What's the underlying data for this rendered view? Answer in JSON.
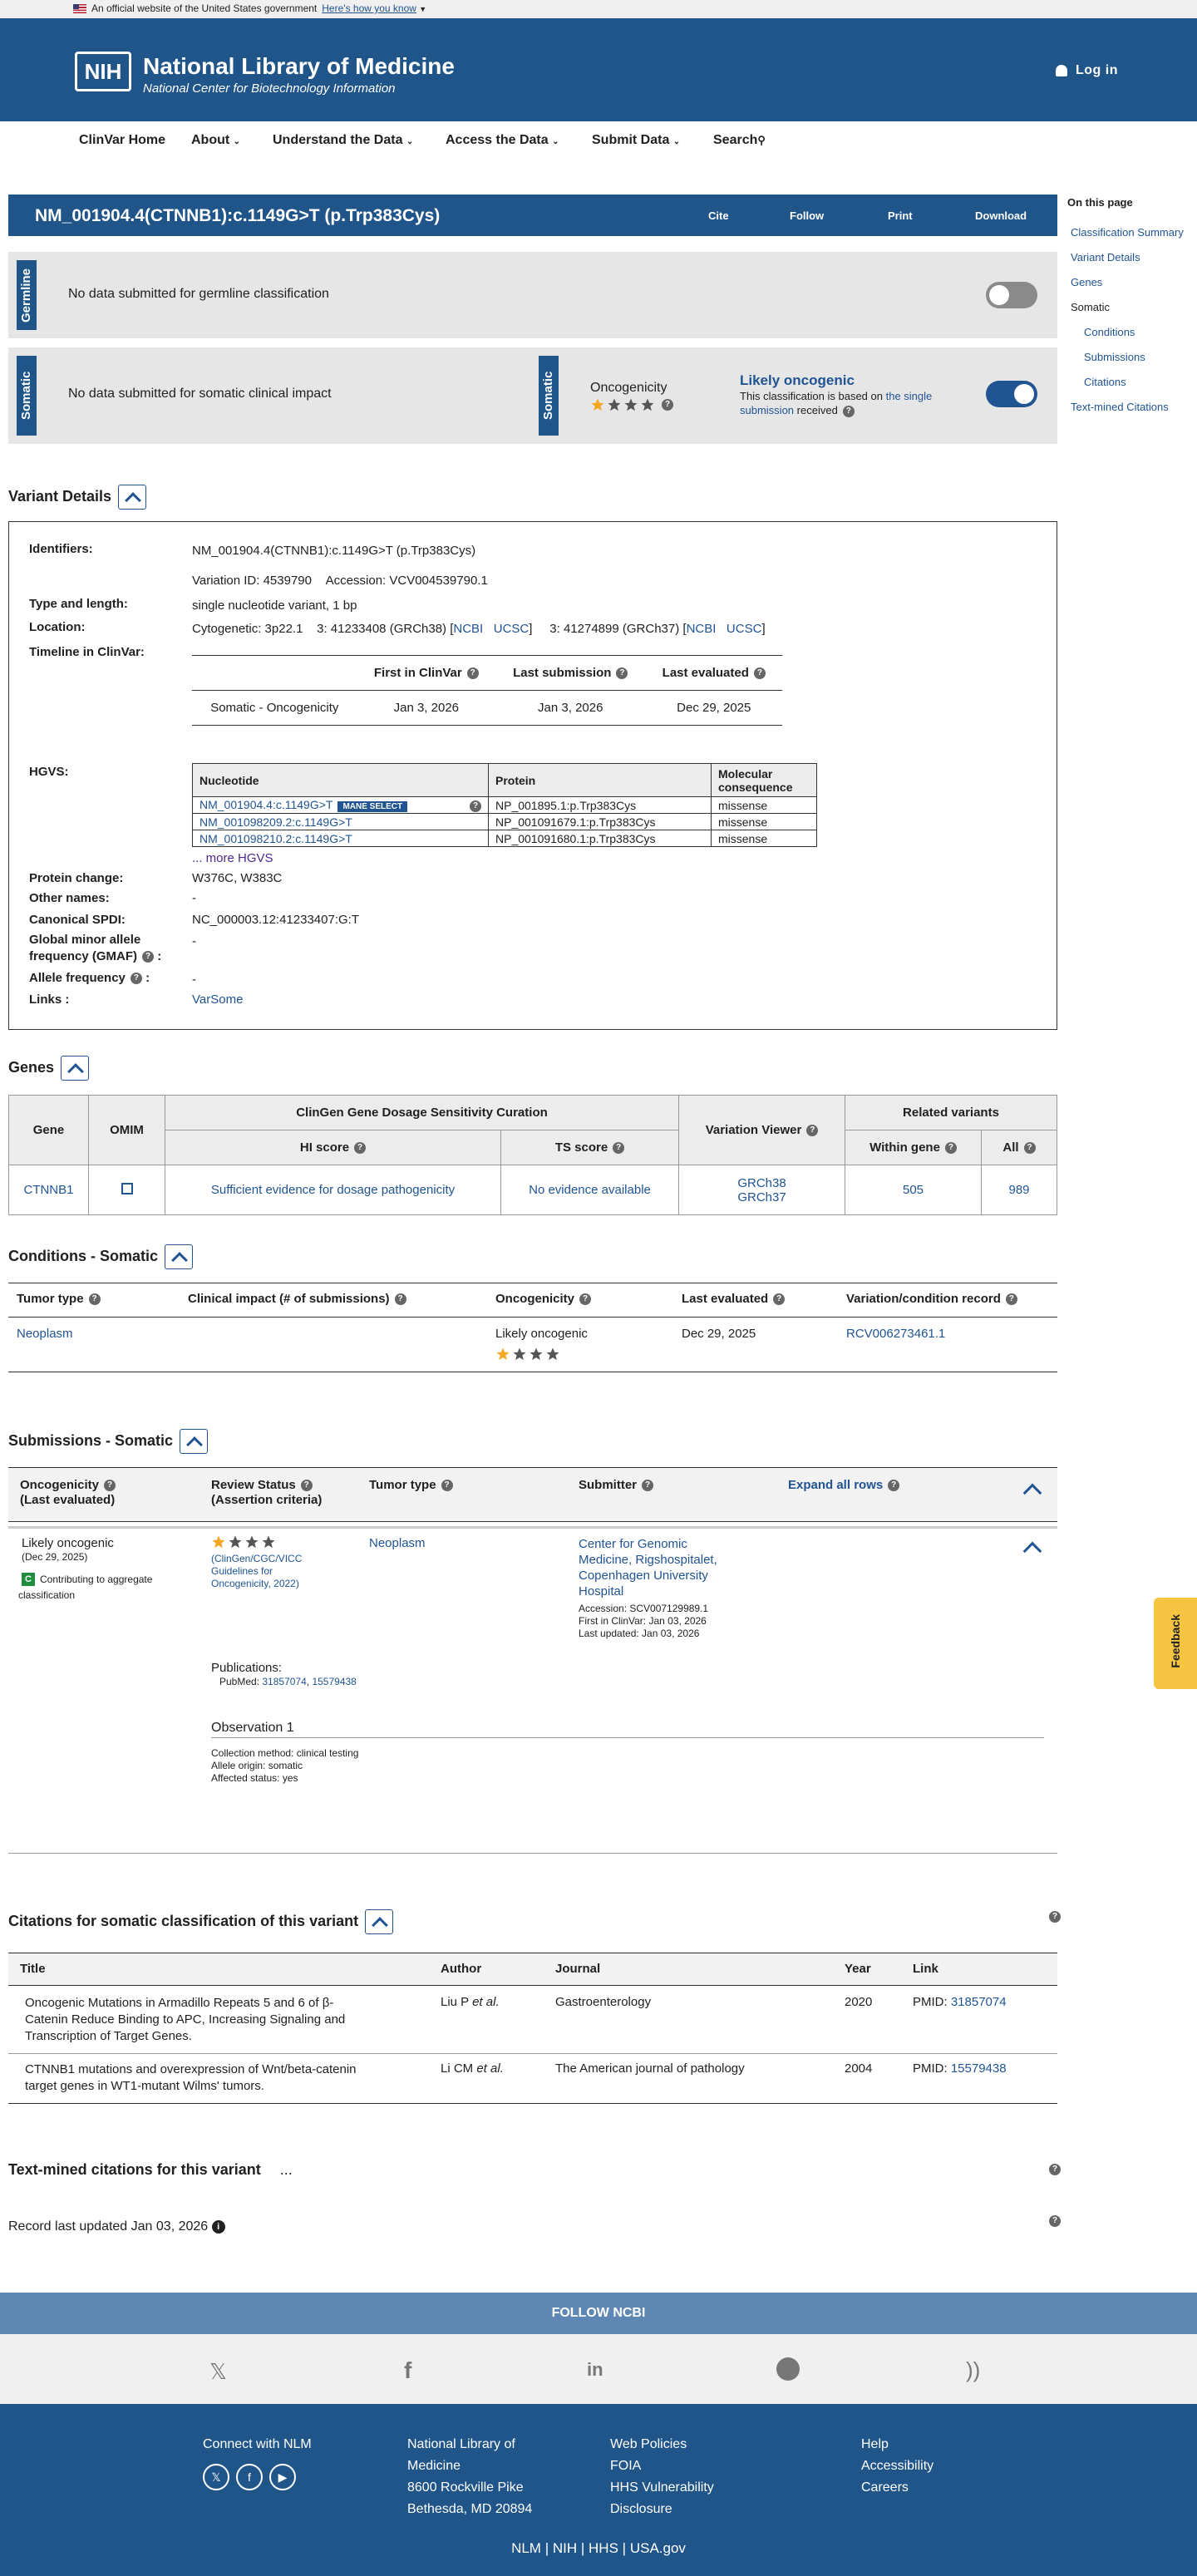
{
  "gov_banner": {
    "text": "An official website of the United States government",
    "link": "Here's how you know"
  },
  "header": {
    "logo": "NIH",
    "title": "National Library of Medicine",
    "subtitle": "National Center for Biotechnology Information",
    "login": "Log in"
  },
  "nav": {
    "items": [
      "ClinVar Home",
      "About",
      "Understand the Data",
      "Access the Data",
      "Submit Data",
      "Search"
    ]
  },
  "title_bar": {
    "title": "NM_001904.4(CTNNB1):c.1149G>T (p.Trp383Cys)",
    "buttons": [
      "Cite",
      "Follow",
      "Print",
      "Download"
    ]
  },
  "germline": {
    "tab": "Germline",
    "text": "No data submitted for germline classification"
  },
  "somatic": {
    "tab": "Somatic",
    "text": "No data submitted for somatic clinical impact",
    "tab2": "Somatic",
    "onco_label": "Oncogenicity",
    "classification": "Likely oncogenic",
    "note1": "This classification is based on",
    "note_link": "the single submission",
    "note2": "received"
  },
  "sidebar": {
    "head": "On this page",
    "items": [
      "Classification Summary",
      "Variant Details",
      "Genes",
      "Somatic",
      "Conditions",
      "Submissions",
      "Citations",
      "Text-mined Citations"
    ]
  },
  "variant_details": {
    "heading": "Variant Details",
    "labels": {
      "identifiers": "Identifiers:",
      "type": "Type and length:",
      "location": "Location:",
      "timeline": "Timeline in ClinVar:",
      "hgvs": "HGVS:",
      "protein": "Protein change:",
      "other": "Other names:",
      "spdi": "Canonical SPDI:",
      "gmaf1": "Global minor allele",
      "gmaf2": "frequency (GMAF)",
      "gmaf_colon": ":",
      "af": "Allele frequency",
      "af_colon": ":",
      "links": "Links :"
    },
    "identifier": "NM_001904.4(CTNNB1):c.1149G>T (p.Trp383Cys)",
    "variation_id": "Variation ID: 4539790",
    "accession": "Accession: VCV004539790.1",
    "type": "single nucleotide variant, 1 bp",
    "location": {
      "cyto": "Cytogenetic: 3p22.1",
      "grch38": "3: 41233408 (GRCh38) [",
      "ncbi": "NCBI",
      "ucsc": "UCSC",
      "close": "]",
      "grch37": "3: 41274899 (GRCh37) [",
      "ncbi2": "NCBI",
      "ucsc2": "UCSC",
      "close2": "]"
    },
    "timeline": {
      "headers": [
        "First in ClinVar",
        "Last submission",
        "Last evaluated"
      ],
      "row": [
        "Somatic - Oncogenicity",
        "Jan 3, 2026",
        "Jan 3, 2026",
        "Dec 29, 2025"
      ]
    },
    "hgvs": {
      "headers": [
        "Nucleotide",
        "Protein",
        "Molecular consequence"
      ],
      "mane": "MANE SELECT",
      "rows": [
        [
          "NM_001904.4:c.1149G>T",
          "NP_001895.1:p.Trp383Cys",
          "missense"
        ],
        [
          "NM_001098209.2:c.1149G>T",
          "NP_001091679.1:p.Trp383Cys",
          "missense"
        ],
        [
          "NM_001098210.2:c.1149G>T",
          "NP_001091680.1:p.Trp383Cys",
          "missense"
        ]
      ],
      "more": "... more HGVS"
    },
    "protein_change": "W376C, W383C",
    "other_names": "-",
    "spdi": "NC_000003.12:41233407:G:T",
    "gmaf": "-",
    "af": "-",
    "links": "VarSome"
  },
  "genes": {
    "heading": "Genes",
    "h": {
      "gene": "Gene",
      "omim": "OMIM",
      "clingen": "ClinGen Gene Dosage Sensitivity Curation",
      "hi": "HI score",
      "ts": "TS score",
      "viewer": "Variation Viewer",
      "related": "Related variants",
      "within": "Within gene",
      "all": "All"
    },
    "row": {
      "gene": "CTNNB1",
      "hi": "Sufficient evidence for dosage pathogenicity",
      "ts": "No evidence available",
      "g38": "GRCh38",
      "g37": "GRCh37",
      "within": "505",
      "all": "989"
    }
  },
  "conditions": {
    "heading": "Conditions - Somatic",
    "headers": [
      "Tumor type",
      "Clinical impact (# of submissions)",
      "Oncogenicity",
      "Last evaluated",
      "Variation/condition record"
    ],
    "row": {
      "tumor": "Neoplasm",
      "onco": "Likely oncogenic",
      "last": "Dec 29, 2025",
      "record": "RCV006273461.1"
    }
  },
  "submissions": {
    "heading": "Submissions - Somatic",
    "headers": {
      "onco1": "Oncogenicity",
      "onco2": "(Last evaluated)",
      "review1": "Review Status",
      "review2": "(Assertion criteria)",
      "tumor": "Tumor type",
      "submitter": "Submitter",
      "expand": "Expand all rows"
    },
    "row": {
      "class": "Likely oncogenic",
      "date": "(Dec 29, 2025)",
      "badge": "C",
      "contrib1": "Contributing to aggregate",
      "contrib2": "classification",
      "criteria": [
        "(ClinGen/CGC/VICC",
        "Guidelines for",
        "Oncogenicity, 2022)"
      ],
      "tumor": "Neoplasm",
      "submitter": [
        "Center for Genomic",
        "Medicine, Rigshospitalet,",
        "Copenhagen University",
        "Hospital"
      ],
      "accession": "Accession: SCV007129989.1",
      "first": "First in ClinVar: Jan 03, 2026",
      "updated": "Last updated: Jan 03, 2026",
      "pubs": "Publications:",
      "pubmed": "PubMed:",
      "pm1": "31857074",
      "comma": ",",
      "pm2": "15579438",
      "obs": "Observation 1",
      "method": "Collection method: clinical testing",
      "origin": "Allele origin: somatic",
      "affected": "Affected status: yes"
    }
  },
  "citations": {
    "heading": "Citations for somatic classification of this variant",
    "headers": [
      "Title",
      "Author",
      "Journal",
      "Year",
      "Link"
    ],
    "rows": [
      {
        "title": [
          "Oncogenic Mutations in Armadillo Repeats 5 and 6 of β-",
          "Catenin Reduce Binding to APC, Increasing Signaling and",
          "Transcription of Target Genes."
        ],
        "author": "Liu P",
        "etal": "et al.",
        "journal": "Gastroenterology",
        "year": "2020",
        "pmid": "PMID:",
        "id": "31857074"
      },
      {
        "title": [
          "CTNNB1 mutations and overexpression of Wnt/beta-catenin",
          "target genes in WT1-mutant Wilms' tumors."
        ],
        "author": "Li CM",
        "etal": "et al.",
        "journal": "The American journal of pathology",
        "year": "2004",
        "pmid": "PMID:",
        "id": "15579438"
      }
    ]
  },
  "text_mined": {
    "heading": "Text-mined citations for this variant",
    "dots": "..."
  },
  "record_updated": "Record last updated Jan 03, 2026",
  "feedback": "Feedback",
  "footer": {
    "follow": "FOLLOW NCBI",
    "connect": "Connect with NLM",
    "nlm": [
      "National Library of",
      "Medicine",
      "8600 Rockville Pike",
      "Bethesda, MD 20894"
    ],
    "col3": [
      "Web Policies",
      "FOIA",
      "HHS Vulnerability",
      "Disclosure"
    ],
    "col4": [
      "Help",
      "Accessibility",
      "Careers"
    ],
    "bottom": [
      "NLM",
      "NIH",
      "HHS",
      "USA.gov"
    ],
    "sep": "|"
  },
  "colors": {
    "primary": "#20558a",
    "link": "#205493",
    "star": "#f5a623",
    "footer_follow": "#5f87b4"
  }
}
